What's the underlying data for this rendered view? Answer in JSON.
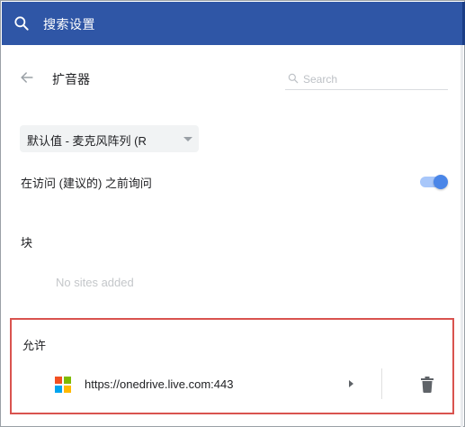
{
  "topbar": {
    "search_label": "搜索设置",
    "bg_color": "#2f56a6",
    "icon": "search-icon"
  },
  "header": {
    "back_icon": "arrow-left-icon",
    "title": "扩音器",
    "search": {
      "placeholder": "Search",
      "value": "",
      "icon": "search-icon"
    }
  },
  "device_select": {
    "selected": "默认值 - 麦克风阵列 (R",
    "icon": "caret-down-icon"
  },
  "ask_before_access": {
    "label": "在访问 (建议的) 之前询问",
    "enabled": true,
    "accent": "#4a86e8"
  },
  "block": {
    "heading": "块",
    "empty_text": "No sites added"
  },
  "allow": {
    "heading": "允许",
    "highlight_color": "#d9534f",
    "sites": [
      {
        "url": "https://onedrive.live.com:443",
        "icon": "microsoft-logo-icon",
        "expand_icon": "caret-right-icon",
        "delete_icon": "trash-icon"
      }
    ]
  }
}
